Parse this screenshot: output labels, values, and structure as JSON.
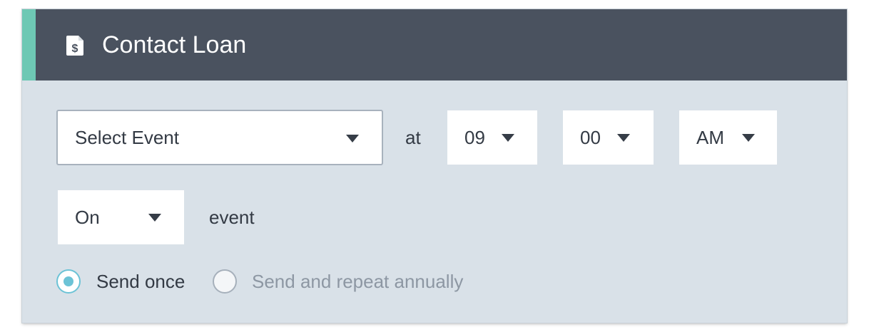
{
  "colors": {
    "accent": "#6ec8b4",
    "header_bg": "#4a525f",
    "panel_bg": "#d9e1e8",
    "radio_selected": "#6cc3d6",
    "muted_text": "#8d97a3"
  },
  "header": {
    "icon": "dollar-document-icon",
    "title": "Contact Loan"
  },
  "schedule": {
    "event_select": {
      "value": "Select Event",
      "icon": "caret-down-icon"
    },
    "at_label": "at",
    "hour_select": {
      "value": "09",
      "icon": "caret-down-icon"
    },
    "minute_select": {
      "value": "00",
      "icon": "caret-down-icon"
    },
    "ampm_select": {
      "value": "AM",
      "icon": "caret-down-icon"
    },
    "relation_select": {
      "value": "On",
      "icon": "caret-down-icon"
    },
    "event_label": "event"
  },
  "repeat": {
    "options": [
      {
        "label": "Send once",
        "selected": true
      },
      {
        "label": "Send and repeat annually",
        "selected": false
      }
    ]
  }
}
